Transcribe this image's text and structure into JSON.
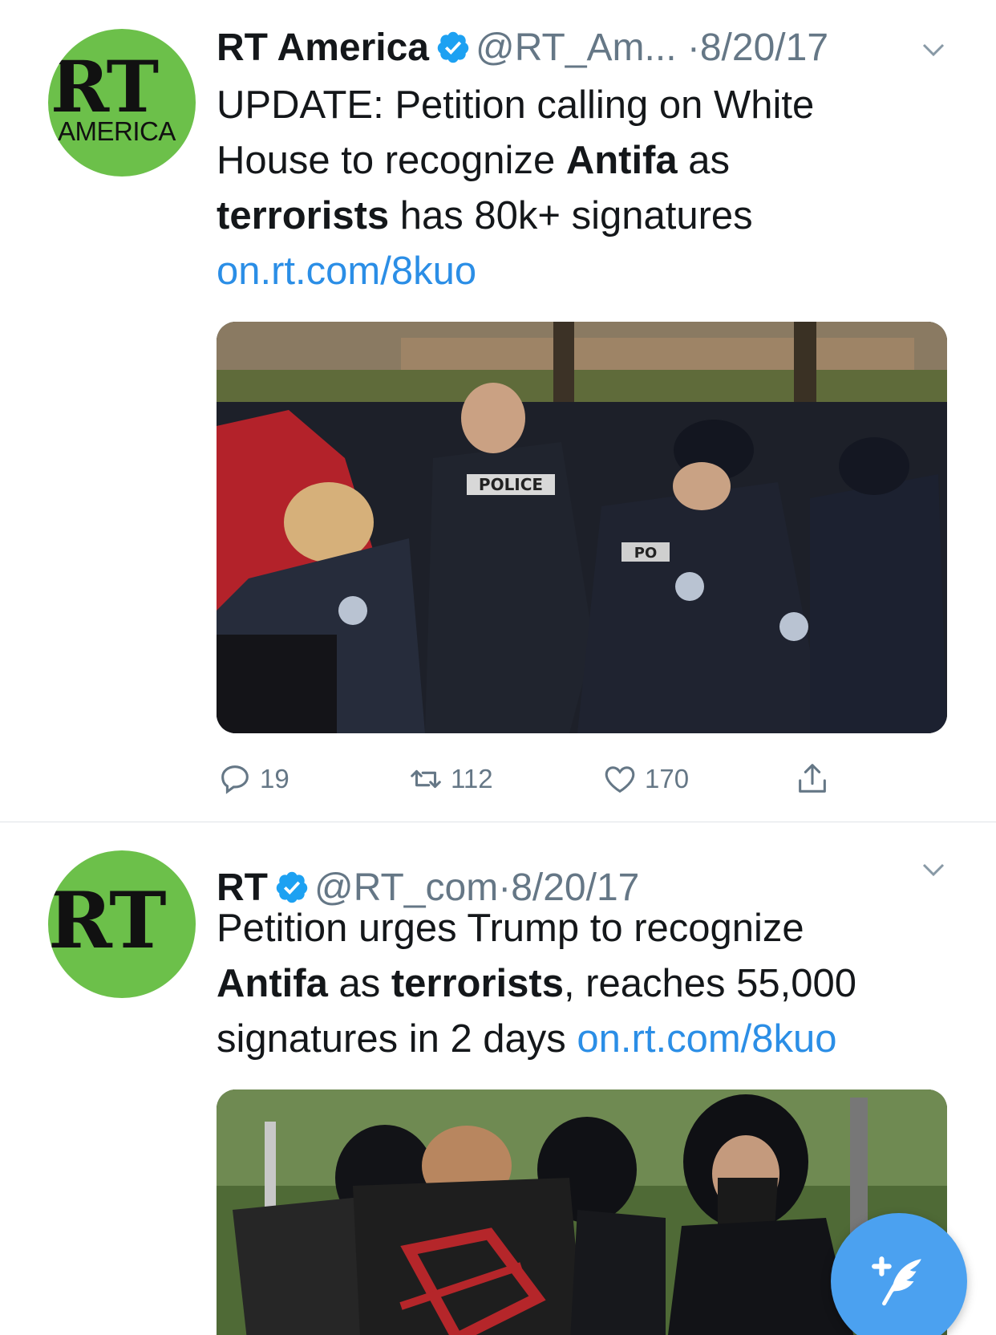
{
  "colors": {
    "link": "#2b8ee6",
    "muted": "#657786",
    "verified": "#1da1f2",
    "rt_green": "#6cc04a",
    "fab": "#4ba1f0"
  },
  "tweets": [
    {
      "avatar": {
        "mark": "RT",
        "sub": "AMERICA"
      },
      "name": "RT America",
      "handle": "@RT_Am...",
      "separator": "·",
      "date": "8/20/17",
      "text": {
        "line1": "UPDATE: Petition calling on White",
        "line2_a": "House to recognize ",
        "line2_b": "Antifa",
        "line2_c": " as",
        "line3_a": "terrorists",
        "line3_b": " has 80k+ signatures",
        "link": "on.rt.com/8kuo"
      },
      "media": {
        "label": "POLICE",
        "label2": "PO"
      },
      "actions": {
        "replies": "19",
        "retweets": "112",
        "likes": "170"
      },
      "icons": [
        "verified-icon",
        "chevron-down-icon",
        "reply-icon",
        "retweet-icon",
        "heart-icon",
        "share-icon"
      ]
    },
    {
      "avatar": {
        "mark": "RT"
      },
      "name": "RT",
      "handle": "@RT_com",
      "separator": "·",
      "date": "8/20/17",
      "text": {
        "line1": "Petition urges Trump to recognize",
        "line2_a": "Antifa",
        "line2_b": " as ",
        "line2_c": "terrorists",
        "line2_d": ", reaches 55,000",
        "line3_a": "signatures in 2 days ",
        "link": "on.rt.com/8kuo"
      },
      "icons": [
        "verified-icon",
        "chevron-down-icon"
      ]
    }
  ],
  "compose_button": {
    "icon": "compose-feather-icon"
  }
}
